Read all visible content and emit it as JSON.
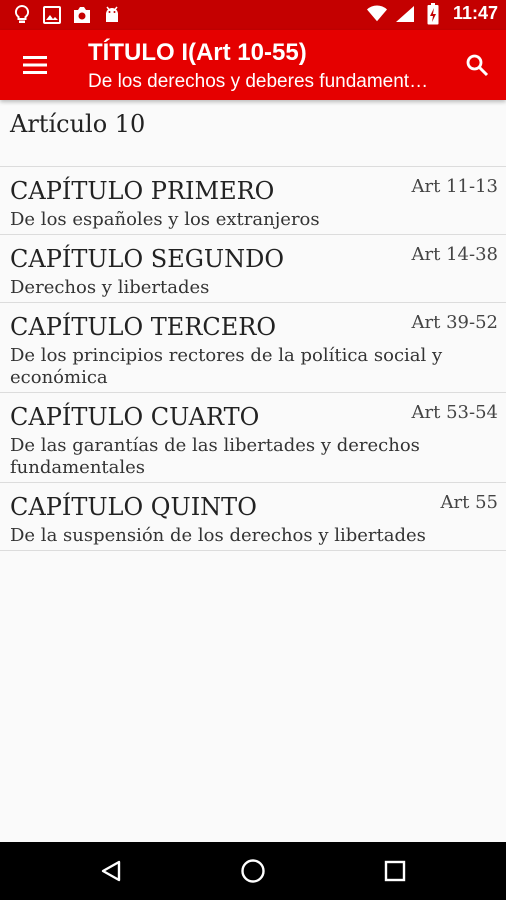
{
  "status_bar": {
    "time": "11:47",
    "left_icons": [
      "lightbulb-icon",
      "image-icon",
      "camera-icon",
      "android-icon"
    ],
    "right_icons": [
      "wifi-icon",
      "signal-icon",
      "battery-icon"
    ]
  },
  "app_bar": {
    "title": "TÍTULO I(Art 10-55)",
    "subtitle": "De los derechos y deberes fundamentales",
    "color": "#e50000"
  },
  "article": {
    "label": "Artículo 10"
  },
  "chapters": [
    {
      "title": "CAPÍTULO PRIMERO",
      "range": "Art 11-13",
      "desc": "De los españoles y los extranjeros"
    },
    {
      "title": "CAPÍTULO SEGUNDO",
      "range": "Art 14-38",
      "desc": "Derechos y libertades"
    },
    {
      "title": "CAPÍTULO TERCERO",
      "range": "Art 39-52",
      "desc": "De los principios rectores de la política social y económica"
    },
    {
      "title": "CAPÍTULO CUARTO",
      "range": "Art 53-54",
      "desc": "De las garantías de las libertades y derechos fundamentales"
    },
    {
      "title": "CAPÍTULO QUINTO",
      "range": "Art 55",
      "desc": "De la suspensión de los derechos y libertades"
    }
  ]
}
